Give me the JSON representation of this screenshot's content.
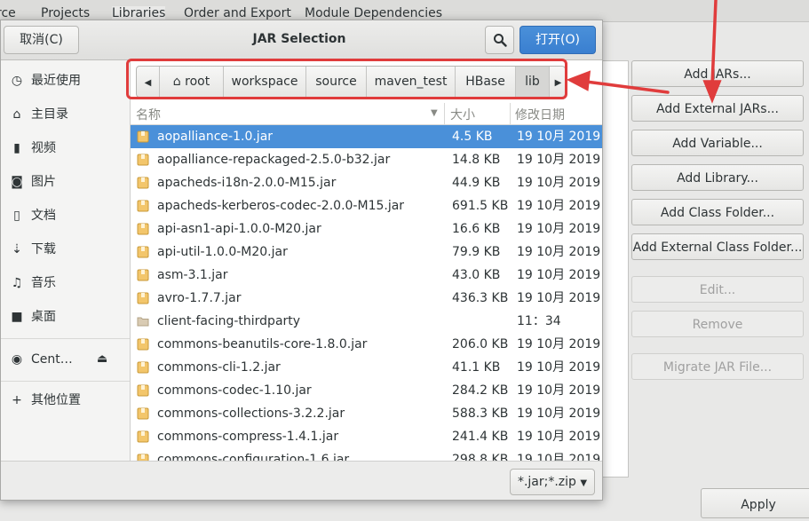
{
  "background": {
    "tabs": [
      "rce",
      "Projects",
      "Libraries",
      "Order and Export",
      "Module Dependencies"
    ],
    "buttons": [
      {
        "label": "Add JARs...",
        "enabled": true
      },
      {
        "label": "Add External JARs...",
        "enabled": true
      },
      {
        "label": "Add Variable...",
        "enabled": true
      },
      {
        "label": "Add Library...",
        "enabled": true
      },
      {
        "label": "Add Class Folder...",
        "enabled": true
      },
      {
        "label": "Add External Class Folder...",
        "enabled": true
      },
      {
        "label": "Edit...",
        "enabled": false
      },
      {
        "label": "Remove",
        "enabled": false
      },
      {
        "label": "Migrate JAR File...",
        "enabled": false
      }
    ],
    "apply_label": "Apply"
  },
  "dialog": {
    "title": "JAR Selection",
    "cancel_label": "取消(C)",
    "open_label": "打开(O)",
    "search_icon": "search-icon",
    "accent": "#4a90d9",
    "highlight": "#e03c3c"
  },
  "sidebar": {
    "items": [
      {
        "icon": "clock-icon",
        "label": "最近使用"
      },
      {
        "icon": "home-icon",
        "label": "主目录"
      },
      {
        "icon": "video-icon",
        "label": "视频"
      },
      {
        "icon": "camera-icon",
        "label": "图片"
      },
      {
        "icon": "document-icon",
        "label": "文档"
      },
      {
        "icon": "download-icon",
        "label": "下载"
      },
      {
        "icon": "music-icon",
        "label": "音乐"
      },
      {
        "icon": "folder-icon",
        "label": "桌面"
      }
    ],
    "device": {
      "icon": "disc-icon",
      "label": "Cent…",
      "eject_icon": "eject-icon"
    },
    "other": {
      "icon": "plus-icon",
      "label": "其他位置"
    }
  },
  "pathbar": {
    "crumbs": [
      "root",
      "workspace",
      "source",
      "maven_test",
      "HBase",
      "lib"
    ]
  },
  "columns": {
    "name": "名称",
    "size": "大小",
    "modified": "修改日期"
  },
  "files": [
    {
      "name": "aopalliance-1.0.jar",
      "size": "4.5 KB",
      "modified": "19 10月 2019",
      "type": "jar",
      "selected": true
    },
    {
      "name": "aopalliance-repackaged-2.5.0-b32.jar",
      "size": "14.8 KB",
      "modified": "19 10月 2019",
      "type": "jar"
    },
    {
      "name": "apacheds-i18n-2.0.0-M15.jar",
      "size": "44.9 KB",
      "modified": "19 10月 2019",
      "type": "jar"
    },
    {
      "name": "apacheds-kerberos-codec-2.0.0-M15.jar",
      "size": "691.5 KB",
      "modified": "19 10月 2019",
      "type": "jar"
    },
    {
      "name": "api-asn1-api-1.0.0-M20.jar",
      "size": "16.6 KB",
      "modified": "19 10月 2019",
      "type": "jar"
    },
    {
      "name": "api-util-1.0.0-M20.jar",
      "size": "79.9 KB",
      "modified": "19 10月 2019",
      "type": "jar"
    },
    {
      "name": "asm-3.1.jar",
      "size": "43.0 KB",
      "modified": "19 10月 2019",
      "type": "jar"
    },
    {
      "name": "avro-1.7.7.jar",
      "size": "436.3 KB",
      "modified": "19 10月 2019",
      "type": "jar"
    },
    {
      "name": "client-facing-thirdparty",
      "size": "",
      "modified": "11：34",
      "type": "folder"
    },
    {
      "name": "commons-beanutils-core-1.8.0.jar",
      "size": "206.0 KB",
      "modified": "19 10月 2019",
      "type": "jar"
    },
    {
      "name": "commons-cli-1.2.jar",
      "size": "41.1 KB",
      "modified": "19 10月 2019",
      "type": "jar"
    },
    {
      "name": "commons-codec-1.10.jar",
      "size": "284.2 KB",
      "modified": "19 10月 2019",
      "type": "jar"
    },
    {
      "name": "commons-collections-3.2.2.jar",
      "size": "588.3 KB",
      "modified": "19 10月 2019",
      "type": "jar"
    },
    {
      "name": "commons-compress-1.4.1.jar",
      "size": "241.4 KB",
      "modified": "19 10月 2019",
      "type": "jar"
    },
    {
      "name": "commons-configuration-1.6.jar",
      "size": "298.8 KB",
      "modified": "19 10月 2019",
      "type": "jar"
    }
  ],
  "footer": {
    "filter_label": "*.jar;*.zip"
  }
}
